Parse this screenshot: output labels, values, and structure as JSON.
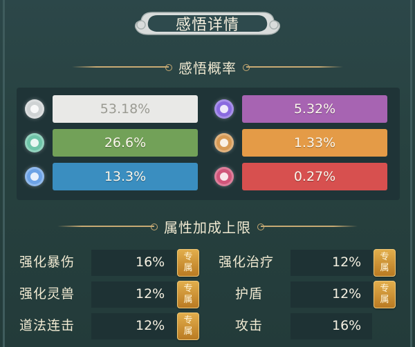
{
  "title": "感悟详情",
  "probability_section": {
    "heading": "感悟概率",
    "items": [
      {
        "value": "53.18%",
        "color": "#e9e9e7",
        "orb": "#cfd3d4",
        "text_color": "#9a9a92"
      },
      {
        "value": "5.32%",
        "color": "#a764b2",
        "orb": "#8a6be0",
        "text_color": "#fbf7ec"
      },
      {
        "value": "26.6%",
        "color": "#72a158",
        "orb": "#6ec4a8",
        "text_color": "#fbf7ec"
      },
      {
        "value": "1.33%",
        "color": "#e49b47",
        "orb": "#d79a55",
        "text_color": "#fbf7ec"
      },
      {
        "value": "13.3%",
        "color": "#3a8ec0",
        "orb": "#6da3e6",
        "text_color": "#fbf7ec"
      },
      {
        "value": "0.27%",
        "color": "#d7504f",
        "orb": "#d0557a",
        "text_color": "#fbf7ec"
      }
    ]
  },
  "attribute_section": {
    "heading": "属性加成上限",
    "rows": [
      {
        "left": {
          "name": "强化暴伤",
          "value": "16%",
          "tag": "专属"
        },
        "right": {
          "name": "强化治疗",
          "value": "12%",
          "tag": "专属"
        }
      },
      {
        "left": {
          "name": "强化灵兽",
          "value": "12%",
          "tag": "专属"
        },
        "right": {
          "name": "护盾",
          "value": "12%",
          "tag": "专属"
        }
      },
      {
        "left": {
          "name": "道法连击",
          "value": "12%",
          "tag": "专属"
        },
        "right": {
          "name": "攻击",
          "value": "16%",
          "tag": ""
        }
      }
    ]
  }
}
